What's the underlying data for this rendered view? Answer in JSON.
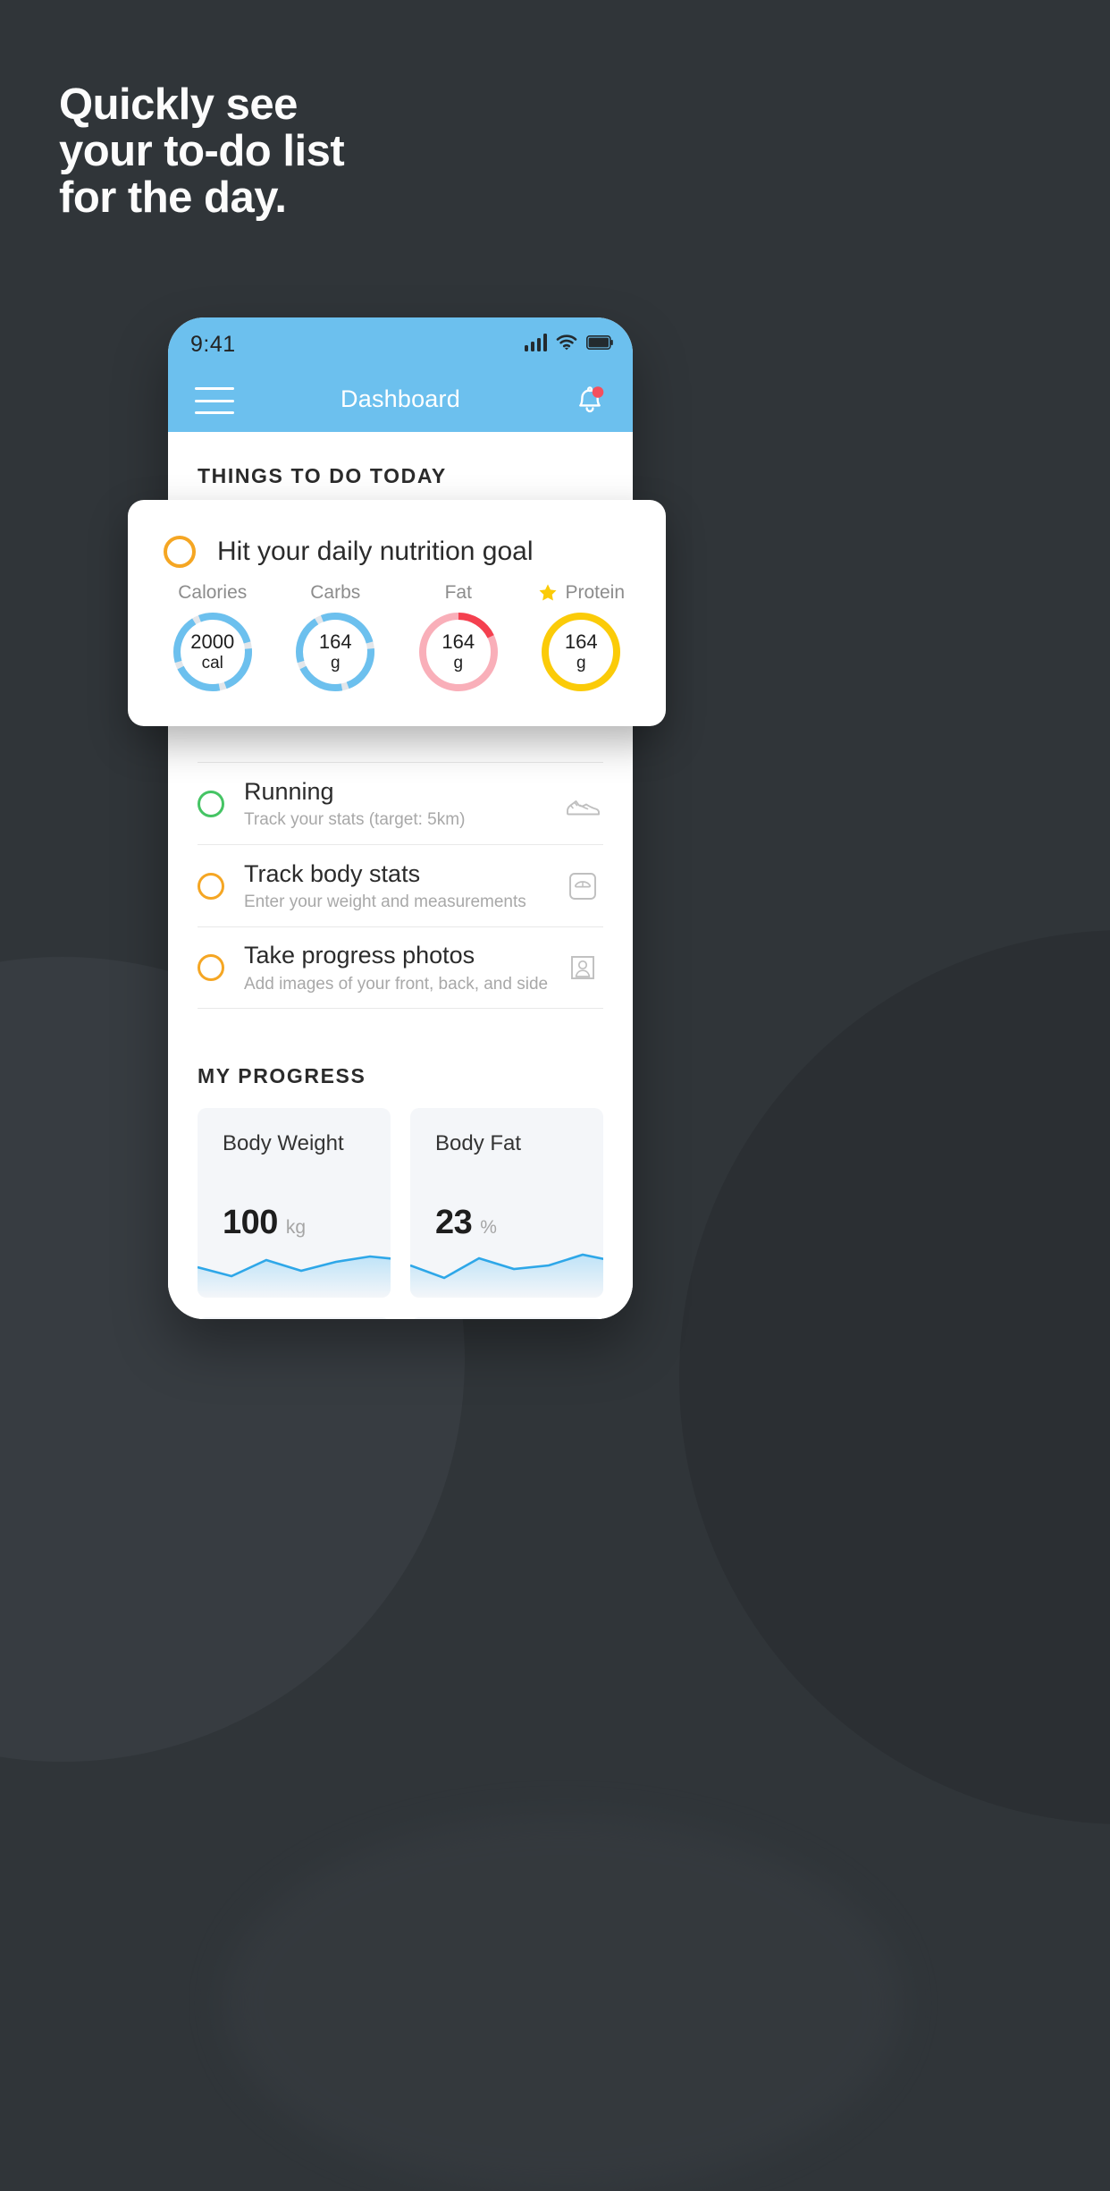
{
  "headline": {
    "line1": "Quickly see",
    "line2": "your to-do list",
    "line3": "for the day."
  },
  "colors": {
    "background": "#303539",
    "accent_blue": "#6CC0EE",
    "amber": "#F5A623",
    "green": "#45C464",
    "red": "#F4707F",
    "yellow": "#FBCB08",
    "spark_blue": "#2EA7E8"
  },
  "phone": {
    "status_bar": {
      "time": "9:41",
      "signal_icon": "signal-bars-icon",
      "wifi_icon": "wifi-icon",
      "battery_icon": "battery-icon"
    },
    "app_bar": {
      "menu_icon": "hamburger-menu-icon",
      "title": "Dashboard",
      "bell_icon": "notification-bell-icon",
      "badge": ""
    },
    "sections": {
      "todo_heading": "THINGS TO DO TODAY",
      "progress_heading": "MY PROGRESS"
    },
    "todos": [
      {
        "title": "Running",
        "subtitle": "Track your stats (target: 5km)",
        "check_color": "green",
        "icon": "sneaker-icon"
      },
      {
        "title": "Track body stats",
        "subtitle": "Enter your weight and measurements",
        "check_color": "amber",
        "icon": "weight-scale-icon"
      },
      {
        "title": "Take progress photos",
        "subtitle": "Add images of your front, back, and side",
        "check_color": "amber",
        "icon": "photo-person-icon"
      }
    ],
    "progress_cards": [
      {
        "label": "Body Weight",
        "value": "100",
        "unit": "kg"
      },
      {
        "label": "Body Fat",
        "value": "23",
        "unit": "%"
      }
    ]
  },
  "nutrition_card": {
    "check_color": "amber",
    "title": "Hit your daily nutrition goal",
    "star_icon": "star-icon",
    "macros": [
      {
        "label": "Calories",
        "value": "2000",
        "unit": "cal",
        "color": "#6CC0EE",
        "starred": false,
        "percent": 88
      },
      {
        "label": "Carbs",
        "value": "164",
        "unit": "g",
        "color": "#6CC0EE",
        "starred": false,
        "percent": 88
      },
      {
        "label": "Fat",
        "value": "164",
        "unit": "g",
        "color": "#F4707F",
        "starred": false,
        "percent": 100
      },
      {
        "label": "Protein",
        "value": "164",
        "unit": "g",
        "color": "#FBCB08",
        "starred": true,
        "percent": 100
      }
    ]
  }
}
